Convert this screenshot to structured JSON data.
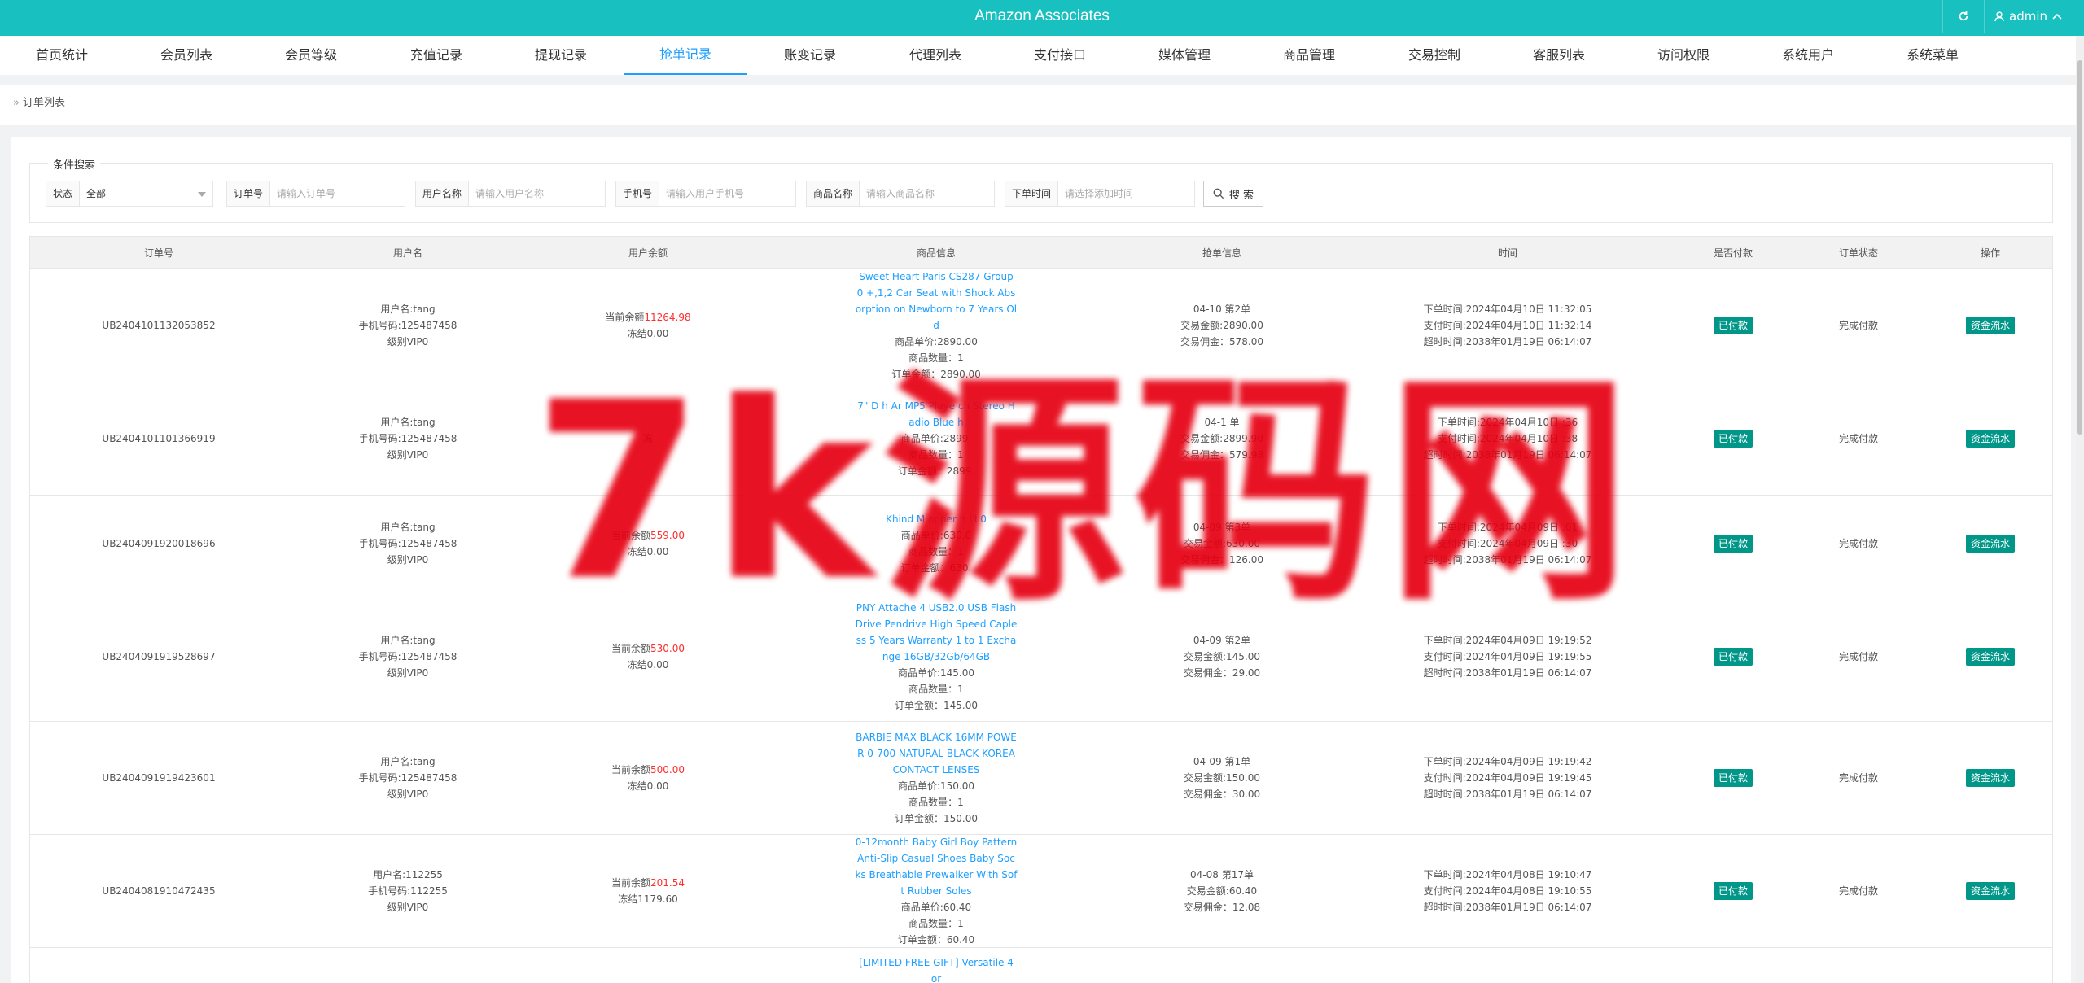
{
  "header": {
    "title": "Amazon Associates",
    "user": "admin"
  },
  "nav": [
    {
      "label": "首页统计"
    },
    {
      "label": "会员列表"
    },
    {
      "label": "会员等级"
    },
    {
      "label": "充值记录"
    },
    {
      "label": "提现记录"
    },
    {
      "label": "抢单记录",
      "active": true
    },
    {
      "label": "账变记录"
    },
    {
      "label": "代理列表"
    },
    {
      "label": "支付接口"
    },
    {
      "label": "媒体管理"
    },
    {
      "label": "商品管理"
    },
    {
      "label": "交易控制"
    },
    {
      "label": "客服列表"
    },
    {
      "label": "访问权限"
    },
    {
      "label": "系统用户"
    },
    {
      "label": "系统菜单"
    }
  ],
  "breadcrumb": "订单列表",
  "search": {
    "legend": "条件搜索",
    "status_label": "状态",
    "status_value": "全部",
    "order_label": "订单号",
    "order_placeholder": "请输入订单号",
    "username_label": "用户名称",
    "username_placeholder": "请输入用户名称",
    "phone_label": "手机号",
    "phone_placeholder": "请输入用户手机号",
    "product_label": "商品名称",
    "product_placeholder": "请输入商品名称",
    "time_label": "下单时间",
    "time_placeholder": "请选择添加时间",
    "button": "搜 索"
  },
  "columns": [
    "订单号",
    "用户名",
    "用户余额",
    "商品信息",
    "抢单信息",
    "时间",
    "是否付款",
    "订单状态",
    "操作"
  ],
  "rows": [
    {
      "order_no": "UB2404101132053852",
      "user_lines": [
        "用户名:tang",
        "手机号码:125487458",
        "级别VIP0"
      ],
      "balance_prefix": "当前余额",
      "balance": "11264.98",
      "frozen": "冻结0.00",
      "product": "Sweet Heart Paris CS287 Group 0 +,1,2 Car Seat with Shock Absorption on Newborn to 7 Years Old",
      "product_lines": [
        "商品单价:2890.00",
        "商品数量：1",
        "订单金额：2890.00"
      ],
      "grab_lines": [
        "04-10 第2单",
        "交易金额:2890.00",
        "交易佣金：578.00"
      ],
      "time_lines": [
        "下单时间:2024年04月10日 11:32:05",
        "支付时间:2024年04月10日 11:32:14",
        "超时时间:2038年01月19日 06:14:07"
      ],
      "paid": "已付款",
      "status": "完成付款",
      "action": "资金流水"
    },
    {
      "order_no": "UB2404101101366919",
      "user_lines": [
        "用户名:tang",
        "手机号码:125487458",
        "级别VIP0"
      ],
      "balance_prefix": "",
      "balance": "",
      "frozen": "冻",
      "product": "7\" D          h Ar          MP5 Playe        ch        Stereo H  adio Blue       h",
      "product_lines": [
        "商品单价:2899.",
        "商品数量：1",
        "订单金额：2899."
      ],
      "grab_lines": [
        "04-1      单",
        "交易金额:2899.90",
        "交易佣金：579.98"
      ],
      "time_lines": [
        "下单时间:2024年04月10日     :36",
        "支付时间:2024年04月10日     :38",
        "超时时间:2038年01月19日 06:14:07"
      ],
      "paid": "已付款",
      "status": "完成付款",
      "action": "资金流水"
    },
    {
      "order_no": "UB2404091920018696",
      "user_lines": [
        "用户名:tang",
        "手机号码:125487458",
        "级别VIP0"
      ],
      "balance_prefix": "当前余额",
      "balance": "559.00",
      "frozen": "冻结0.00",
      "product": "Khind M     opper    h LI  0",
      "product_lines": [
        "商品单价:630.0",
        "商品数量：1",
        "订单金额：630."
      ],
      "grab_lines": [
        "04-09 第3单",
        "交易金额:630.00",
        "交易佣金：126.00"
      ],
      "time_lines": [
        "下单时间:2024年04月09日     :01",
        "支付时间:2024年04月09日     :30",
        "超时时间:2038年01月19日 06:14:07"
      ],
      "paid": "已付款",
      "status": "完成付款",
      "action": "资金流水"
    },
    {
      "order_no": "UB2404091919528697",
      "user_lines": [
        "用户名:tang",
        "手机号码:125487458",
        "级别VIP0"
      ],
      "balance_prefix": "当前余额",
      "balance": "530.00",
      "frozen": "冻结0.00",
      "product": "PNY Attache 4 USB2.0 USB Flash Drive Pendrive High Speed Capless 5 Years Warranty 1 to 1 Exchange 16GB/32Gb/64GB",
      "product_lines": [
        "商品单价:145.00",
        "商品数量：1",
        "订单金额：145.00"
      ],
      "grab_lines": [
        "04-09 第2单",
        "交易金额:145.00",
        "交易佣金：29.00"
      ],
      "time_lines": [
        "下单时间:2024年04月09日 19:19:52",
        "支付时间:2024年04月09日 19:19:55",
        "超时时间:2038年01月19日 06:14:07"
      ],
      "paid": "已付款",
      "status": "完成付款",
      "action": "资金流水"
    },
    {
      "order_no": "UB2404091919423601",
      "user_lines": [
        "用户名:tang",
        "手机号码:125487458",
        "级别VIP0"
      ],
      "balance_prefix": "当前余额",
      "balance": "500.00",
      "frozen": "冻结0.00",
      "product": "BARBIE MAX BLACK 16MM POWER 0-700 NATURAL BLACK KOREA CONTACT LENSES",
      "product_lines": [
        "商品单价:150.00",
        "商品数量：1",
        "订单金额：150.00"
      ],
      "grab_lines": [
        "04-09 第1单",
        "交易金额:150.00",
        "交易佣金：30.00"
      ],
      "time_lines": [
        "下单时间:2024年04月09日 19:19:42",
        "支付时间:2024年04月09日 19:19:45",
        "超时时间:2038年01月19日 06:14:07"
      ],
      "paid": "已付款",
      "status": "完成付款",
      "action": "资金流水"
    },
    {
      "order_no": "UB2404081910472435",
      "user_lines": [
        "用户名:112255",
        "手机号码:112255",
        "级别VIP0"
      ],
      "balance_prefix": "当前余额",
      "balance": "201.54",
      "frozen": "冻结1179.60",
      "product": "0-12month Baby Girl Boy Pattern Anti-Slip Casual Shoes Baby Socks Breathable Prewalker With Soft Rubber Soles",
      "product_lines": [
        "商品单价:60.40",
        "商品数量：1",
        "订单金额：60.40"
      ],
      "grab_lines": [
        "04-08 第17单",
        "交易金额:60.40",
        "交易佣金：12.08"
      ],
      "time_lines": [
        "下单时间:2024年04月08日 19:10:47",
        "支付时间:2024年04月08日 19:10:55",
        "超时时间:2038年01月19日 06:14:07"
      ],
      "paid": "已付款",
      "status": "完成付款",
      "action": "资金流水"
    },
    {
      "order_no": "",
      "user_lines": [
        "",
        "",
        ""
      ],
      "balance_prefix": "",
      "balance": "",
      "frozen": "",
      "product": "[LIMITED FREE GIFT] Versatile 4 or",
      "product_lines": [
        "",
        "",
        ""
      ],
      "grab_lines": [
        "",
        "",
        ""
      ],
      "time_lines": [
        "",
        "",
        ""
      ],
      "paid": "",
      "status": "",
      "action": ""
    }
  ],
  "watermark": "7k源码网",
  "colors": {
    "header": "#18c0c0",
    "active_tab": "#1e9fff",
    "badge": "#009688",
    "balance": "#ff2d2d",
    "watermark": "#e60012"
  }
}
